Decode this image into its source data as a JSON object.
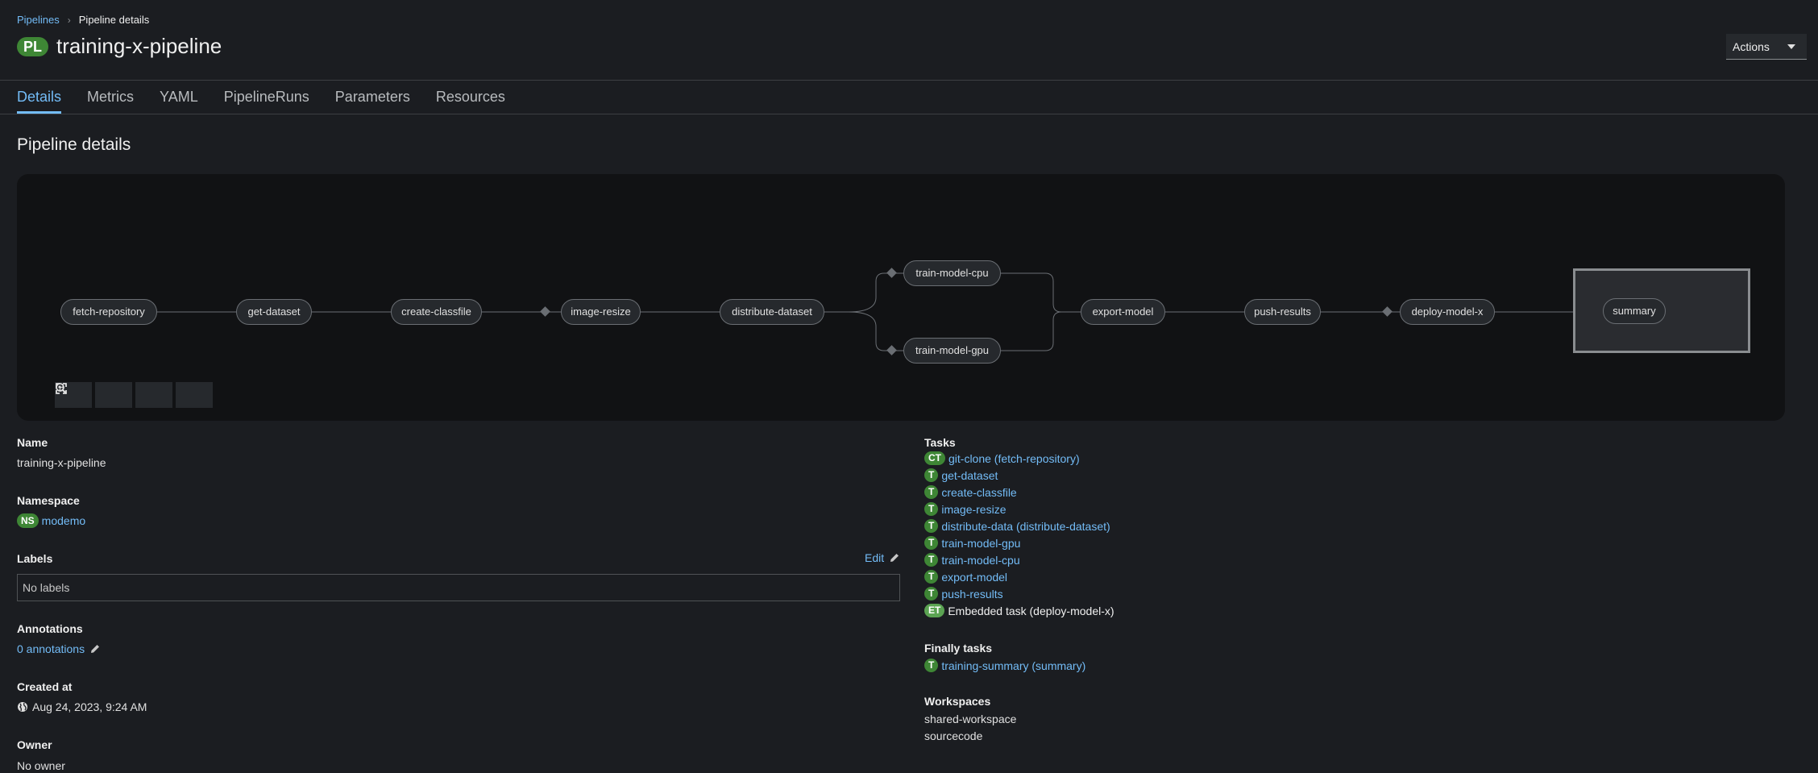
{
  "breadcrumb": {
    "parent": "Pipelines",
    "current": "Pipeline details"
  },
  "header": {
    "badge": "PL",
    "title": "training-x-pipeline",
    "actions_label": "Actions"
  },
  "tabs": [
    {
      "label": "Details",
      "active": true
    },
    {
      "label": "Metrics"
    },
    {
      "label": "YAML"
    },
    {
      "label": "PipelineRuns"
    },
    {
      "label": "Parameters"
    },
    {
      "label": "Resources"
    }
  ],
  "section_title": "Pipeline details",
  "graph": {
    "nodes": [
      "fetch-repository",
      "get-dataset",
      "create-classfile",
      "image-resize",
      "distribute-dataset",
      "train-model-cpu",
      "train-model-gpu",
      "export-model",
      "push-results",
      "deploy-model-x",
      "summary"
    ],
    "zoom_controls": [
      "zoom-in-icon",
      "zoom-out-icon",
      "fit-to-screen-icon",
      "fullscreen-icon"
    ]
  },
  "details": {
    "name_label": "Name",
    "name_value": "training-x-pipeline",
    "namespace_label": "Namespace",
    "namespace_badge": "NS",
    "namespace_value": "modemo",
    "labels_label": "Labels",
    "labels_edit": "Edit",
    "labels_value": "No labels",
    "annotations_label": "Annotations",
    "annotations_value": "0 annotations",
    "created_label": "Created at",
    "created_value": "Aug 24, 2023, 9:24 AM",
    "owner_label": "Owner",
    "owner_value": "No owner"
  },
  "tasks": {
    "label": "Tasks",
    "items": [
      {
        "badge": "CT",
        "text": "git-clone (fetch-repository)",
        "link": true
      },
      {
        "badge": "T",
        "text": "get-dataset",
        "link": true
      },
      {
        "badge": "T",
        "text": "create-classfile",
        "link": true
      },
      {
        "badge": "T",
        "text": "image-resize",
        "link": true
      },
      {
        "badge": "T",
        "text": "distribute-data (distribute-dataset)",
        "link": true
      },
      {
        "badge": "T",
        "text": "train-model-gpu",
        "link": true
      },
      {
        "badge": "T",
        "text": "train-model-cpu",
        "link": true
      },
      {
        "badge": "T",
        "text": "export-model",
        "link": true
      },
      {
        "badge": "T",
        "text": "push-results",
        "link": true
      },
      {
        "badge": "ET",
        "text": "Embedded task (deploy-model-x)",
        "link": false
      }
    ],
    "finally_label": "Finally tasks",
    "finally_items": [
      {
        "badge": "T",
        "text": "training-summary (summary)",
        "link": true
      }
    ],
    "workspaces_label": "Workspaces",
    "workspaces": [
      "shared-workspace",
      "sourcecode"
    ]
  },
  "colors": {
    "accent": "#73bcf7",
    "badge_green": "#3e8635",
    "background": "#1b1d21"
  }
}
